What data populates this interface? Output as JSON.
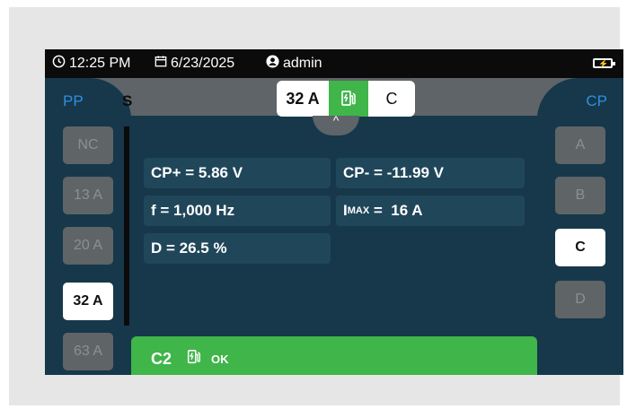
{
  "status_bar": {
    "time": "12:25 PM",
    "date": "6/23/2025",
    "user": "admin",
    "icons": {
      "clock": "clock-icon",
      "calendar": "calendar-icon",
      "user": "user-icon",
      "battery": "battery-charging-icon"
    }
  },
  "header": {
    "left_label": "PP",
    "right_label": "CP",
    "left_fragment": "S",
    "current": "32 A",
    "state": "C",
    "collapse_glyph": "^"
  },
  "pp_buttons": [
    {
      "label": "NC",
      "active": false
    },
    {
      "label": "13 A",
      "active": false
    },
    {
      "label": "20 A",
      "active": false
    },
    {
      "label": "32 A",
      "active": true
    },
    {
      "label": "63 A",
      "active": false
    }
  ],
  "cp_buttons": [
    {
      "label": "A",
      "active": false
    },
    {
      "label": "B",
      "active": false
    },
    {
      "label": "C",
      "active": true
    },
    {
      "label": "D",
      "active": false
    }
  ],
  "readings": {
    "cp_plus": "CP+ =  5.86 V",
    "cp_minus": "CP- =  -11.99 V",
    "freq": "f =  1,000 Hz",
    "imax_prefix": "I",
    "imax_sub": "MAX",
    "imax_rest": " =  16 A",
    "duty": "D =  26.5 %"
  },
  "bottom": {
    "code": "C2",
    "status": "OK"
  },
  "colors": {
    "screen_bg": "#16384a",
    "accent_green": "#3fb54a",
    "label_blue": "#2d8fe0",
    "reading_bg": "#20465a"
  }
}
